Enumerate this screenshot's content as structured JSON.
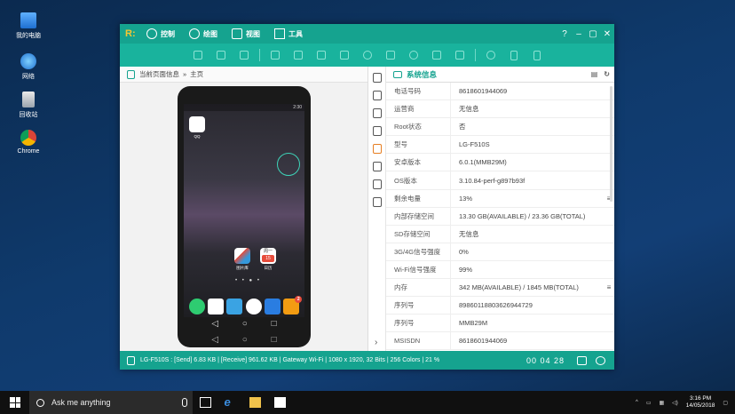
{
  "desktop": {
    "icons": [
      {
        "label": "我的电脑",
        "icon": "computer-icon"
      },
      {
        "label": "网络",
        "icon": "network-icon"
      },
      {
        "label": "回收站",
        "icon": "recycle-bin-icon"
      },
      {
        "label": "Chrome",
        "icon": "chrome-icon"
      }
    ]
  },
  "window": {
    "menu": [
      {
        "label": "控制",
        "icon": "control-icon"
      },
      {
        "label": "绘图",
        "icon": "draw-icon"
      },
      {
        "label": "视图",
        "icon": "view-icon"
      },
      {
        "label": "工具",
        "icon": "tools-icon"
      }
    ],
    "controls": {
      "help": "?",
      "minimize": "–",
      "restore": "▢",
      "close": "✕"
    },
    "breadcrumb": {
      "parent": "当前页面信息",
      "sep": "»",
      "current": "主页"
    },
    "phone": {
      "time": "2:30",
      "apps": [
        {
          "label": "QQ"
        },
        {
          "label": "图片库"
        },
        {
          "label": "日历"
        }
      ],
      "calendar_weekday": "周一",
      "calendar_day": "15",
      "badge": "2",
      "nav": {
        "back": "◁",
        "home": "○",
        "recent": "□"
      }
    },
    "info": {
      "title": "系统信息",
      "rows": [
        {
          "key": "电话号码",
          "value": "8618601944069"
        },
        {
          "key": "运营商",
          "value": "无信息"
        },
        {
          "key": "Root状态",
          "value": "否"
        },
        {
          "key": "型号",
          "value": "LG-F510S"
        },
        {
          "key": "安卓版本",
          "value": "6.0.1(MMB29M)"
        },
        {
          "key": "OS版本",
          "value": "3.10.84-perf-g897b93f"
        },
        {
          "key": "剩余电量",
          "value": "13%",
          "menu": "≡"
        },
        {
          "key": "内部存储空间",
          "value": "13.30 GB(AVAILABLE) / 23.36 GB(TOTAL)"
        },
        {
          "key": "SD存储空间",
          "value": "无信息"
        },
        {
          "key": "3G/4G信号强度",
          "value": "0%"
        },
        {
          "key": "Wi-Fi信号强度",
          "value": "99%"
        },
        {
          "key": "内存",
          "value": "342 MB(AVAILABLE) / 1845 MB(TOTAL)",
          "menu": "≡"
        },
        {
          "key": "序列号",
          "value": "89860118803626944729"
        },
        {
          "key": "序列号",
          "value": "MMB29M"
        },
        {
          "key": "MSISDN",
          "value": "8618601944069"
        }
      ],
      "expand": "›"
    },
    "statusbar": {
      "text": "LG-F510S : [Send] 6.83 KB  |  [Receive] 961.62 KB  |  Gateway Wi-Fi  |  1080 x 1920, 32 Bits  |  256 Colors  |  21 %",
      "timer": "00 04 28"
    }
  },
  "taskbar": {
    "search_placeholder": "Ask me anything",
    "time": "3:16 PM",
    "date": "14/05/2018"
  },
  "colors": {
    "accent": "#15a38f",
    "toolbar": "#19b39d"
  }
}
